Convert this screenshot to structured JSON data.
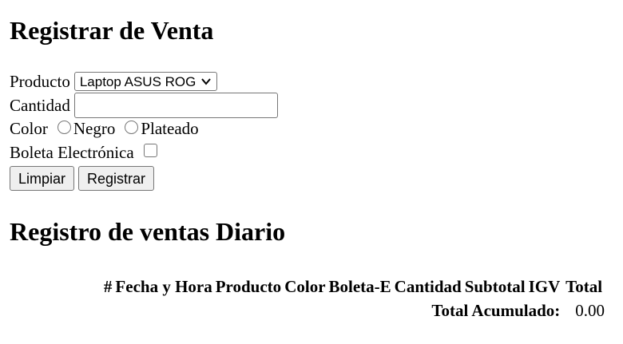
{
  "form": {
    "title": "Registrar de Venta",
    "producto_label": "Producto",
    "producto_selected": "Laptop ASUS ROG",
    "cantidad_label": "Cantidad",
    "cantidad_value": "",
    "color_label": "Color",
    "color_options": [
      "Negro",
      "Plateado"
    ],
    "boleta_label": "Boleta Electrónica",
    "limpiar_button": "Limpiar",
    "registrar_button": "Registrar"
  },
  "registro": {
    "title": "Registro de ventas Diario",
    "columns": [
      "#",
      "Fecha y Hora",
      "Producto",
      "Color",
      "Boleta-E",
      "Cantidad",
      "Subtotal",
      "IGV",
      "Total"
    ],
    "total_label": "Total Acumulado:",
    "total_value": "0.00"
  }
}
